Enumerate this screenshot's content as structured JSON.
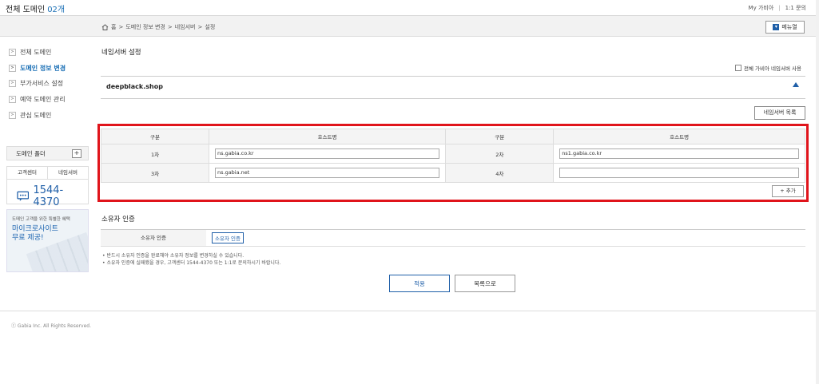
{
  "header": {
    "title": "전체 도메인",
    "count": "02개",
    "links": [
      "My 가비아",
      "1:1 문의"
    ]
  },
  "breadcrumb": {
    "home": "홈",
    "items": [
      "도메인 정보 변경",
      "네임서버",
      "설정"
    ]
  },
  "menu_button": "메뉴열",
  "sidebar": {
    "items": [
      {
        "label": "전체 도메인",
        "active": false
      },
      {
        "label": "도메인 정보 변경",
        "active": true
      },
      {
        "label": "부가서비스 설정",
        "active": false
      },
      {
        "label": "예약 도메인 관리",
        "active": false
      },
      {
        "label": "관심 도메인",
        "active": false
      }
    ],
    "folder_label": "도메인 폴더",
    "cs_tabs": [
      "고객센터",
      "네임서버"
    ],
    "phone": "1544-4370",
    "promo_sub": "도메인 고객을 위한 특별한 혜택",
    "promo_line1": "마이크로사이트",
    "promo_line2": "무료 제공!"
  },
  "main": {
    "title": "네임서버 설정",
    "all_ns_checkbox": "전체 가비아 네임서버 사용",
    "domain": "deepblack.shop",
    "ns_list_button": "네임서버 목록",
    "table": {
      "headers": [
        "구분",
        "호스트명",
        "구분",
        "호스트명"
      ],
      "rows": [
        {
          "l1": "1차",
          "v1": "ns.gabia.co.kr",
          "l2": "2차",
          "v2": "ns1.gabia.co.kr"
        },
        {
          "l1": "3차",
          "v1": "ns.gabia.net",
          "l2": "4차",
          "v2": ""
        }
      ]
    },
    "add_button": "+ 추가",
    "owner": {
      "title": "소유자 인증",
      "label": "소유자 인증",
      "button": "소유자 인증"
    },
    "notes": [
      "반드시 소유자 인증을 완료해야 소유자 정보를 변경하실 수 있습니다.",
      "소유자 인증에 실패했을 경우, 고객센터 1544-4370 또는 1:1로 문의하시기 바랍니다."
    ],
    "apply_button": "적용",
    "list_button": "목록으로"
  },
  "footer": {
    "copyright": "ⓒ Gabia Inc. All Rights Reserved."
  },
  "colors": {
    "accent": "#1f5fa8",
    "highlight": "#e0141b"
  }
}
